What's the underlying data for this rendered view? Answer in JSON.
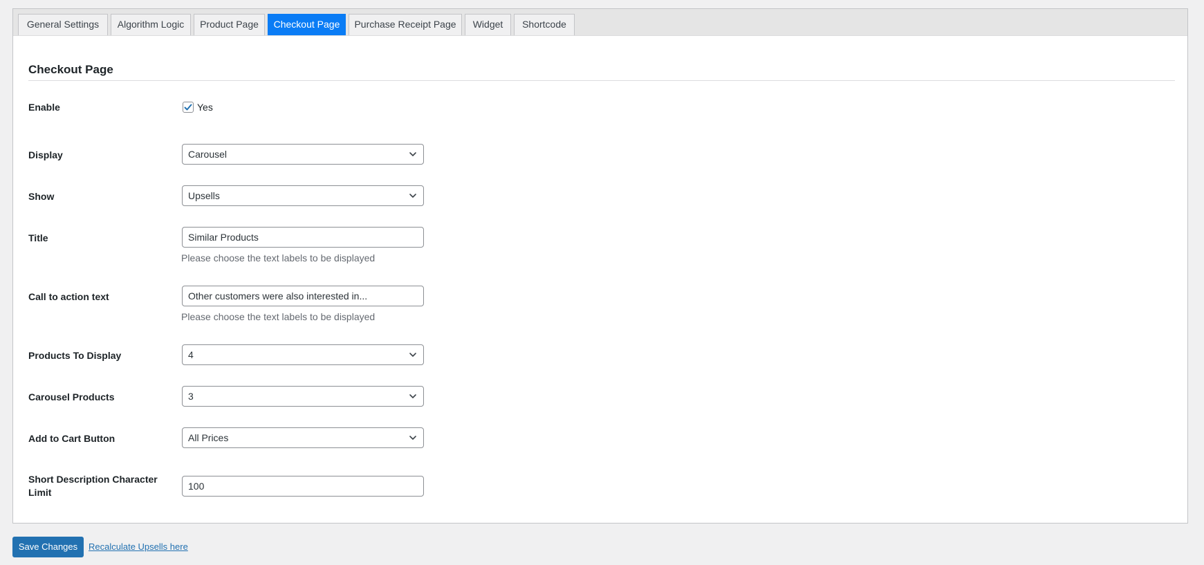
{
  "tabs": [
    {
      "label": "General Settings",
      "active": false
    },
    {
      "label": "Algorithm Logic",
      "active": false
    },
    {
      "label": "Product Page",
      "active": false
    },
    {
      "label": "Checkout Page",
      "active": true
    },
    {
      "label": "Purchase Receipt Page",
      "active": false
    },
    {
      "label": "Widget",
      "active": false
    },
    {
      "label": "Shortcode",
      "active": false
    }
  ],
  "section": {
    "title": "Checkout Page"
  },
  "fields": {
    "enable": {
      "label": "Enable",
      "checked": true,
      "option_label": "Yes"
    },
    "display": {
      "label": "Display",
      "value": "Carousel"
    },
    "show": {
      "label": "Show",
      "value": "Upsells"
    },
    "title": {
      "label": "Title",
      "value": "Similar Products",
      "help": "Please choose the text labels to be displayed"
    },
    "cta": {
      "label": "Call to action text",
      "value": "Other customers were also interested in...",
      "help": "Please choose the text labels to be displayed"
    },
    "products_to_display": {
      "label": "Products To Display",
      "value": "4"
    },
    "carousel_products": {
      "label": "Carousel Products",
      "value": "3"
    },
    "add_to_cart": {
      "label": "Add to Cart Button",
      "value": "All Prices"
    },
    "short_desc_limit": {
      "label_line1": "Short Description Character",
      "label_line2": "Limit",
      "value": "100"
    }
  },
  "footer": {
    "save_label": "Save Changes",
    "recalc_label": "Recalculate Upsells here"
  },
  "colors": {
    "active_tab": "#0a7cf5",
    "primary_button": "#2271b1",
    "link": "#2271b1"
  },
  "icons": {
    "select_arrow": "chevron-down-icon",
    "checkbox": "checkmark-icon"
  }
}
